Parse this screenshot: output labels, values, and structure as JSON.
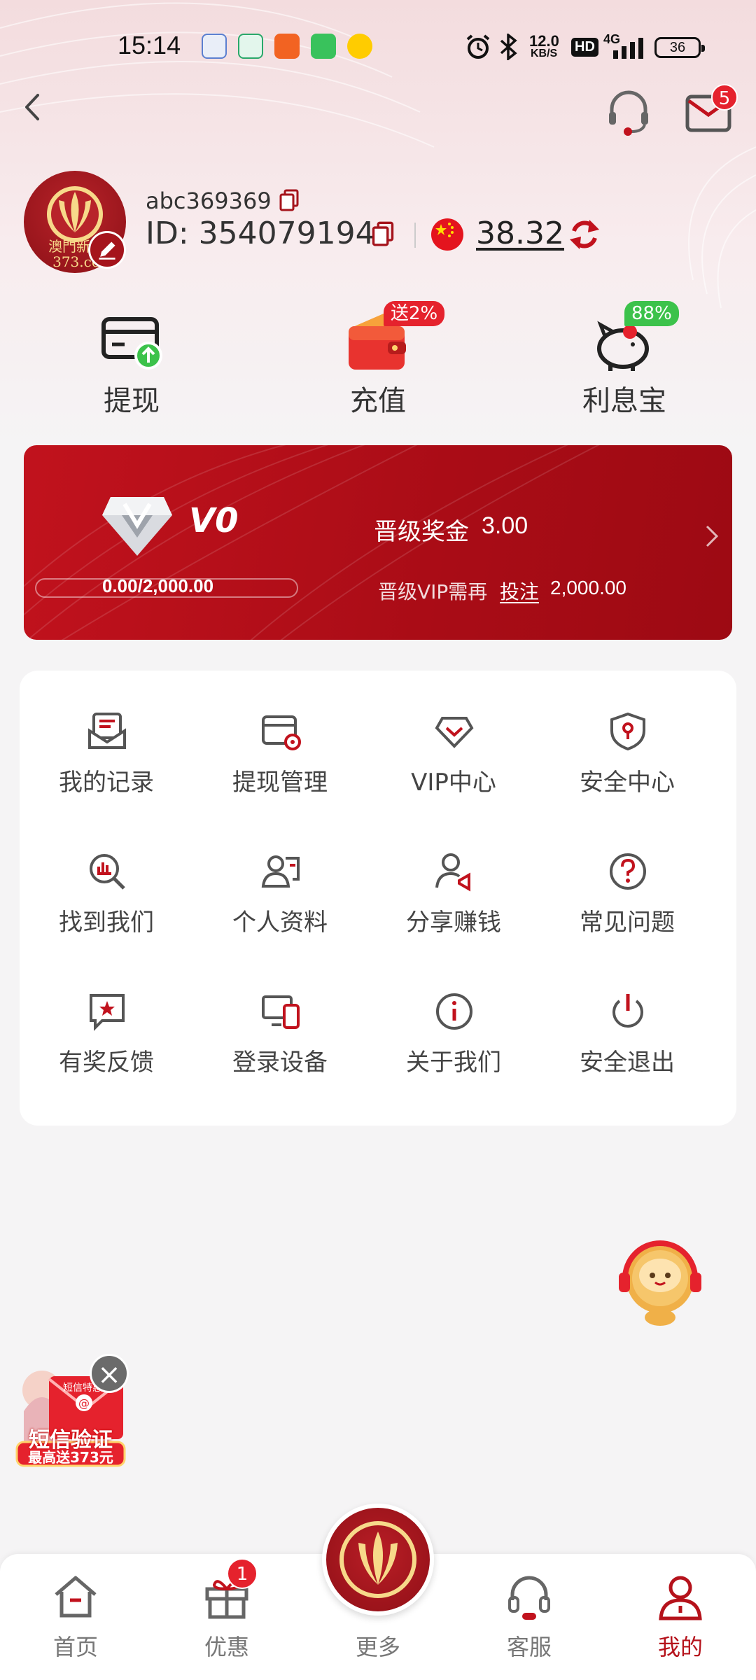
{
  "status_bar": {
    "time": "15:14",
    "net_speed_value": "12.0",
    "net_speed_unit": "KB/S",
    "hd_label": "HD",
    "network_label": "4G",
    "battery": "36"
  },
  "header": {
    "mail_badge": "5"
  },
  "profile": {
    "username": "abc369369",
    "id_label": "ID: 354079194",
    "balance": "38.32",
    "avatar_text": "澳門新葡",
    "avatar_sub": "373.co"
  },
  "quick_actions": [
    {
      "label": "提现",
      "badge": ""
    },
    {
      "label": "充值",
      "badge": "送2%"
    },
    {
      "label": "利息宝",
      "badge": "88%"
    }
  ],
  "vip": {
    "level": "V0",
    "bonus_label": "晋级奖金",
    "bonus_value": "3.00",
    "progress_text": "0.00/2,000.00",
    "progress_fraction": 0,
    "need_label": "晋级VIP需再",
    "bet_label": "投注",
    "need_value": "2,000.00"
  },
  "menu": [
    {
      "label": "我的记录",
      "icon": "record-icon"
    },
    {
      "label": "提现管理",
      "icon": "withdraw-manage-icon"
    },
    {
      "label": "VIP中心",
      "icon": "vip-icon"
    },
    {
      "label": "安全中心",
      "icon": "shield-icon"
    },
    {
      "label": "找到我们",
      "icon": "find-us-icon"
    },
    {
      "label": "个人资料",
      "icon": "profile-icon"
    },
    {
      "label": "分享赚钱",
      "icon": "share-icon"
    },
    {
      "label": "常见问题",
      "icon": "question-icon"
    },
    {
      "label": "有奖反馈",
      "icon": "feedback-icon"
    },
    {
      "label": "登录设备",
      "icon": "devices-icon"
    },
    {
      "label": "关于我们",
      "icon": "info-icon"
    },
    {
      "label": "安全退出",
      "icon": "power-icon"
    }
  ],
  "promo": {
    "tag": "短信特惠",
    "title": "短信验证",
    "subtitle": "最高送373元"
  },
  "bottom_nav": {
    "items": [
      {
        "label": "首页"
      },
      {
        "label": "优惠",
        "badge": "1"
      },
      {
        "label": "更多"
      },
      {
        "label": "客服"
      },
      {
        "label": "我的"
      }
    ]
  },
  "colors": {
    "brand_red": "#b5121b",
    "badge_red": "#e5222d",
    "badge_green": "#3cc24b"
  }
}
